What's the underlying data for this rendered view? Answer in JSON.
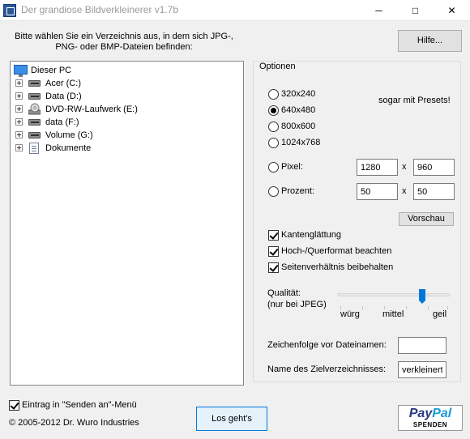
{
  "window": {
    "title": "Der grandiose Bildverkleinerer v1.7b",
    "minimize": "─",
    "maximize": "□",
    "close": "✕"
  },
  "header": {
    "instruction_line1": "Bitte wählen Sie ein Verzeichnis aus, in dem sich JPG-,",
    "instruction_line2": "PNG- oder BMP-Dateien befinden:",
    "help_button": "Hilfe..."
  },
  "tree": {
    "root": "Dieser PC",
    "items": [
      {
        "label": "Acer (C:)",
        "icon": "drive-icon"
      },
      {
        "label": "Data (D:)",
        "icon": "drive-icon"
      },
      {
        "label": "DVD-RW-Laufwerk (E:)",
        "icon": "dvd-icon"
      },
      {
        "label": "data (F:)",
        "icon": "drive-icon"
      },
      {
        "label": "Volume (G:)",
        "icon": "drive-icon"
      },
      {
        "label": "Dokumente",
        "icon": "document-icon"
      }
    ]
  },
  "options": {
    "group_title": "Optionen",
    "presets_note": "sogar mit Presets!",
    "resolutions": [
      {
        "label": "320x240",
        "checked": false
      },
      {
        "label": "640x480",
        "checked": true
      },
      {
        "label": "800x600",
        "checked": false
      },
      {
        "label": "1024x768",
        "checked": false
      }
    ],
    "pixel": {
      "label": "Pixel:",
      "width": "1280",
      "height": "960",
      "separator": "x"
    },
    "percent": {
      "label": "Prozent:",
      "width": "50",
      "height": "50",
      "separator": "x"
    },
    "preview_button": "Vorschau",
    "checkboxes": [
      {
        "label": "Kantenglättung",
        "checked": true
      },
      {
        "label": "Hoch-/Querformat beachten",
        "checked": true
      },
      {
        "label": "Seitenverhältnis beibehalten",
        "checked": true
      }
    ],
    "quality": {
      "label_line1": "Qualität:",
      "label_line2": "(nur bei JPEG)",
      "low": "würg",
      "mid": "mittel",
      "high": "geil",
      "level": 0.75
    },
    "prefix": {
      "label": "Zeichenfolge vor Dateinamen:",
      "value": ""
    },
    "target_dir": {
      "label": "Name des Zielverzeichnisses:",
      "value": "verkleinert"
    }
  },
  "footer": {
    "sendto_label": "Eintrag in \"Senden an\"-Menü",
    "sendto_checked": true,
    "copyright": "© 2005-2012 Dr. Wuro Industries",
    "go_button": "Los geht's",
    "paypal_pay": "Pay",
    "paypal_pal": "Pal",
    "paypal_sub": "SPENDEN"
  }
}
